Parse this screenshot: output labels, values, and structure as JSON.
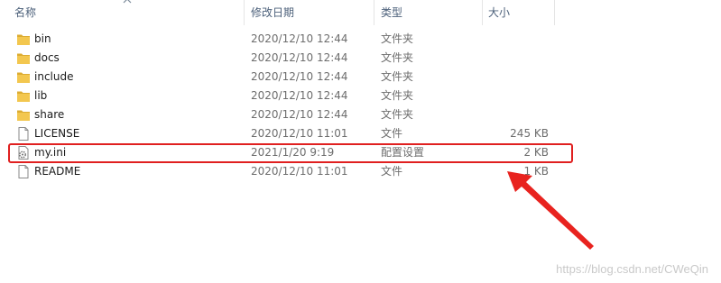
{
  "columns": {
    "name": "名称",
    "date": "修改日期",
    "type": "类型",
    "size": "大小"
  },
  "files": [
    {
      "icon": "folder-icon",
      "name": "bin",
      "date": "2020/12/10 12:44",
      "type": "文件夹",
      "size": ""
    },
    {
      "icon": "folder-icon",
      "name": "docs",
      "date": "2020/12/10 12:44",
      "type": "文件夹",
      "size": ""
    },
    {
      "icon": "folder-icon",
      "name": "include",
      "date": "2020/12/10 12:44",
      "type": "文件夹",
      "size": ""
    },
    {
      "icon": "folder-icon",
      "name": "lib",
      "date": "2020/12/10 12:44",
      "type": "文件夹",
      "size": ""
    },
    {
      "icon": "folder-icon",
      "name": "share",
      "date": "2020/12/10 12:44",
      "type": "文件夹",
      "size": ""
    },
    {
      "icon": "file-icon",
      "name": "LICENSE",
      "date": "2020/12/10 11:01",
      "type": "文件",
      "size": "245 KB"
    },
    {
      "icon": "config-file-icon",
      "name": "my.ini",
      "date": "2021/1/20 9:19",
      "type": "配置设置",
      "size": "2 KB"
    },
    {
      "icon": "file-icon",
      "name": "README",
      "date": "2020/12/10 11:01",
      "type": "文件",
      "size": "1 KB"
    }
  ],
  "watermark": "https://blog.csdn.net/CWeQin",
  "colors": {
    "folder": "#f3c74f",
    "highlight": "#e02020",
    "header_text": "#4c607a"
  }
}
